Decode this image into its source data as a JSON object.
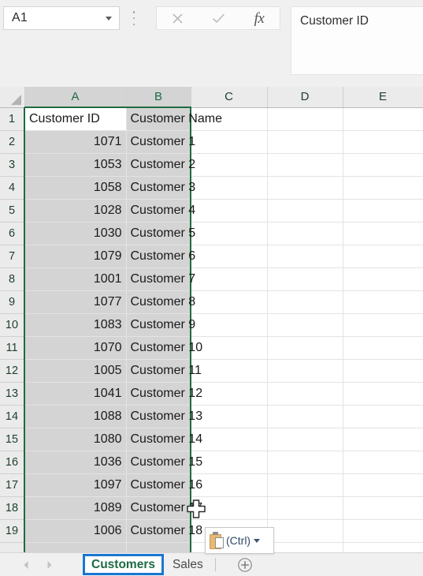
{
  "formula_bar": {
    "name_box_value": "A1",
    "name_box_placeholder": "Name Box",
    "cancel_icon": "close-x-icon",
    "enter_icon": "checkmark-icon",
    "function_icon": "insert-function-fx-icon",
    "fx_label": "fx",
    "formula_value": "Customer ID",
    "formula_placeholder": "",
    "more_options_icon": "vertical-ellipsis-icon"
  },
  "grid": {
    "select_all_icon": "select-all-corner-icon",
    "columns": [
      {
        "label": "A",
        "selected": true
      },
      {
        "label": "B",
        "selected": true
      },
      {
        "label": "C",
        "selected": false
      },
      {
        "label": "D",
        "selected": false
      },
      {
        "label": "E",
        "selected": false
      }
    ],
    "rows": [
      {
        "num": "1",
        "a": "Customer ID",
        "b": "Customer Name",
        "a_align": "txt"
      },
      {
        "num": "2",
        "a": "1071",
        "b": "Customer 1",
        "a_align": "num"
      },
      {
        "num": "3",
        "a": "1053",
        "b": "Customer 2",
        "a_align": "num"
      },
      {
        "num": "4",
        "a": "1058",
        "b": "Customer 3",
        "a_align": "num"
      },
      {
        "num": "5",
        "a": "1028",
        "b": "Customer 4",
        "a_align": "num"
      },
      {
        "num": "6",
        "a": "1030",
        "b": "Customer 5",
        "a_align": "num"
      },
      {
        "num": "7",
        "a": "1079",
        "b": "Customer 6",
        "a_align": "num"
      },
      {
        "num": "8",
        "a": "1001",
        "b": "Customer 7",
        "a_align": "num"
      },
      {
        "num": "9",
        "a": "1077",
        "b": "Customer 8",
        "a_align": "num"
      },
      {
        "num": "10",
        "a": "1083",
        "b": "Customer 9",
        "a_align": "num"
      },
      {
        "num": "11",
        "a": "1070",
        "b": "Customer 10",
        "a_align": "num"
      },
      {
        "num": "12",
        "a": "1005",
        "b": "Customer 11",
        "a_align": "num"
      },
      {
        "num": "13",
        "a": "1041",
        "b": "Customer 12",
        "a_align": "num"
      },
      {
        "num": "14",
        "a": "1088",
        "b": "Customer 13",
        "a_align": "num"
      },
      {
        "num": "15",
        "a": "1080",
        "b": "Customer 14",
        "a_align": "num"
      },
      {
        "num": "16",
        "a": "1036",
        "b": "Customer 15",
        "a_align": "num"
      },
      {
        "num": "17",
        "a": "1097",
        "b": "Customer 16",
        "a_align": "num"
      },
      {
        "num": "18",
        "a": "1089",
        "b": "Customer 17",
        "a_align": "num"
      },
      {
        "num": "19",
        "a": "1006",
        "b": "Customer 18",
        "a_align": "num"
      }
    ],
    "active_cell": "A1",
    "selection_range": "A:B",
    "selection_color": "#1e6b41",
    "selection_fill": "#d4d4d4"
  },
  "paste_options": {
    "icon": "paste-clipboard-icon",
    "label": "(Ctrl)",
    "caret_icon": "chevron-down-icon"
  },
  "cursor": {
    "icon": "cell-select-cross-cursor"
  },
  "tab_bar": {
    "first_sheet_icon": "previous-sheet-arrow-icon",
    "prev_sheet_icon": "next-sheet-arrow-icon",
    "tabs": [
      {
        "label": "Customers",
        "active": true
      },
      {
        "label": "Sales",
        "active": false
      }
    ],
    "add_sheet_icon": "add-sheet-plus-icon",
    "active_tab_outline_color": "#1b76d2",
    "active_tab_text_color": "#1c6b44"
  }
}
